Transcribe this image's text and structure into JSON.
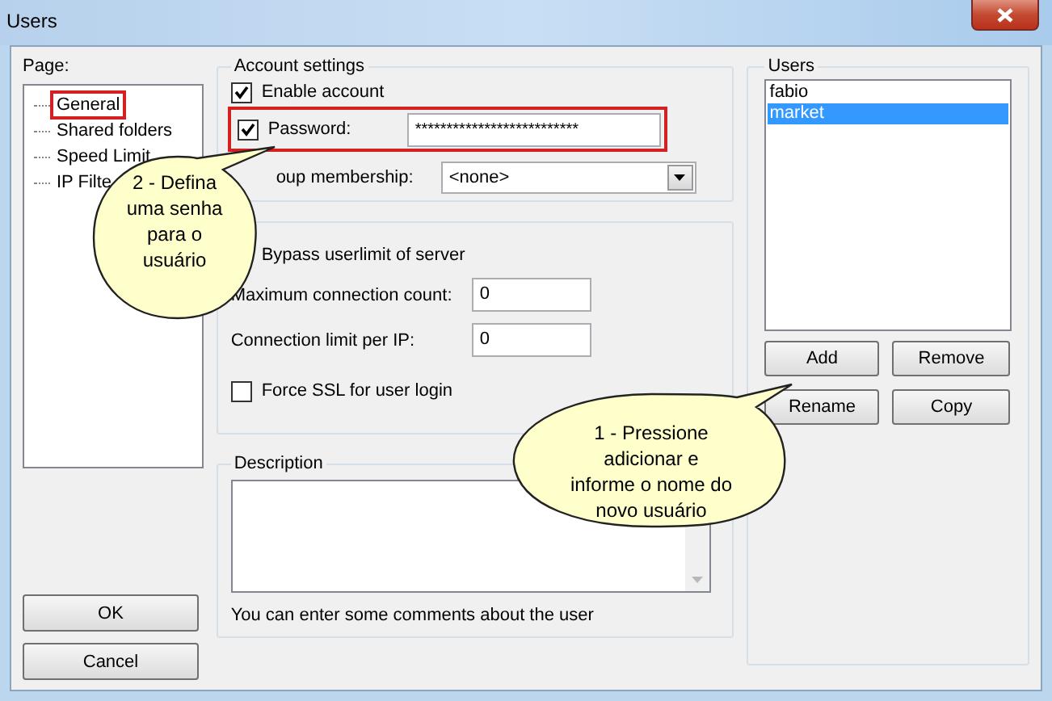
{
  "window": {
    "title": "Users"
  },
  "page_tree": {
    "label": "Page:",
    "items": [
      {
        "label": "General",
        "highlighted": true
      },
      {
        "label": "Shared folders",
        "highlighted": false
      },
      {
        "label": "Speed Limit",
        "highlighted": false
      },
      {
        "label": "IP Filte",
        "highlighted": false
      }
    ]
  },
  "account_settings": {
    "title": "Account settings",
    "enable_account": {
      "label": "Enable account",
      "checked": true
    },
    "password": {
      "label": "Password:",
      "checked": true,
      "value": "**************************",
      "highlighted": true
    },
    "group_membership": {
      "label": "oup membership:",
      "value": "<none>"
    }
  },
  "limits": {
    "bypass": {
      "label": "Bypass userlimit of server"
    },
    "max_connections": {
      "label": "Maximum connection count:",
      "value": "0"
    },
    "per_ip": {
      "label": "Connection limit per IP:",
      "value": "0"
    },
    "force_ssl": {
      "label": "Force SSL for user login",
      "checked": false
    }
  },
  "description": {
    "title": "Description",
    "hint": "You can enter some comments about the user"
  },
  "users": {
    "title": "Users",
    "items": [
      {
        "name": "fabio",
        "selected": false
      },
      {
        "name": "market",
        "selected": true
      }
    ],
    "buttons": [
      "Add",
      "Remove",
      "Rename",
      "Copy"
    ]
  },
  "dialog_buttons": [
    "OK",
    "Cancel"
  ],
  "callouts": [
    {
      "lines": [
        "2 - Defina",
        "uma senha",
        "para o",
        "usuário"
      ]
    },
    {
      "lines": [
        "1 - Pressione",
        "adicionar e",
        "informe o nome do",
        "novo usuário"
      ]
    }
  ]
}
